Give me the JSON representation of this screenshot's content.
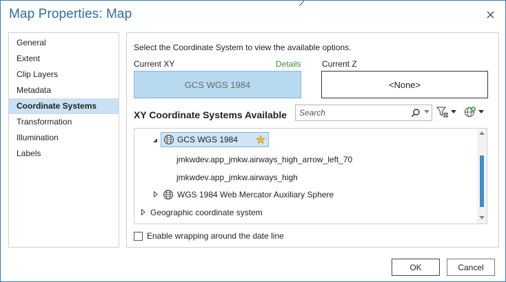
{
  "dialog": {
    "title": "Map Properties: Map"
  },
  "sidebar": {
    "items": [
      {
        "label": "General"
      },
      {
        "label": "Extent"
      },
      {
        "label": "Clip Layers"
      },
      {
        "label": "Metadata"
      },
      {
        "label": "Coordinate Systems",
        "active": true
      },
      {
        "label": "Transformation"
      },
      {
        "label": "Illumination"
      },
      {
        "label": "Labels"
      }
    ]
  },
  "main": {
    "instruction": "Select the Coordinate System to view the available options.",
    "current_xy_label": "Current XY",
    "details_link": "Details",
    "current_z_label": "Current Z",
    "current_xy_value": "GCS WGS 1984",
    "current_z_value": "<None>",
    "available_title": "XY Coordinate Systems Available",
    "search": {
      "placeholder": "Search"
    },
    "tree": [
      {
        "label": "GCS WGS 1984",
        "expanded": true,
        "selected": true,
        "icon": "globe-icon",
        "favorite": "pin-icon"
      },
      {
        "label": "jmkwdev.app_jmkw.airways_high_arrow_left_70"
      },
      {
        "label": "jmkwdev.app_jmkw.airways_high"
      },
      {
        "label": "WGS 1984 Web Mercator Auxiliary Sphere",
        "expanded": false,
        "icon": "globe-icon"
      },
      {
        "label": "Geographic coordinate system",
        "expanded": false
      }
    ],
    "wrap_label": "Enable wrapping around the date line",
    "wrap_checked": false
  },
  "buttons": {
    "ok": "OK",
    "cancel": "Cancel"
  },
  "colors": {
    "title": "#2b6ea6",
    "selection": "#b8daf0",
    "details": "#3a8c3a",
    "scroll_thumb": "#3a8fd0"
  }
}
